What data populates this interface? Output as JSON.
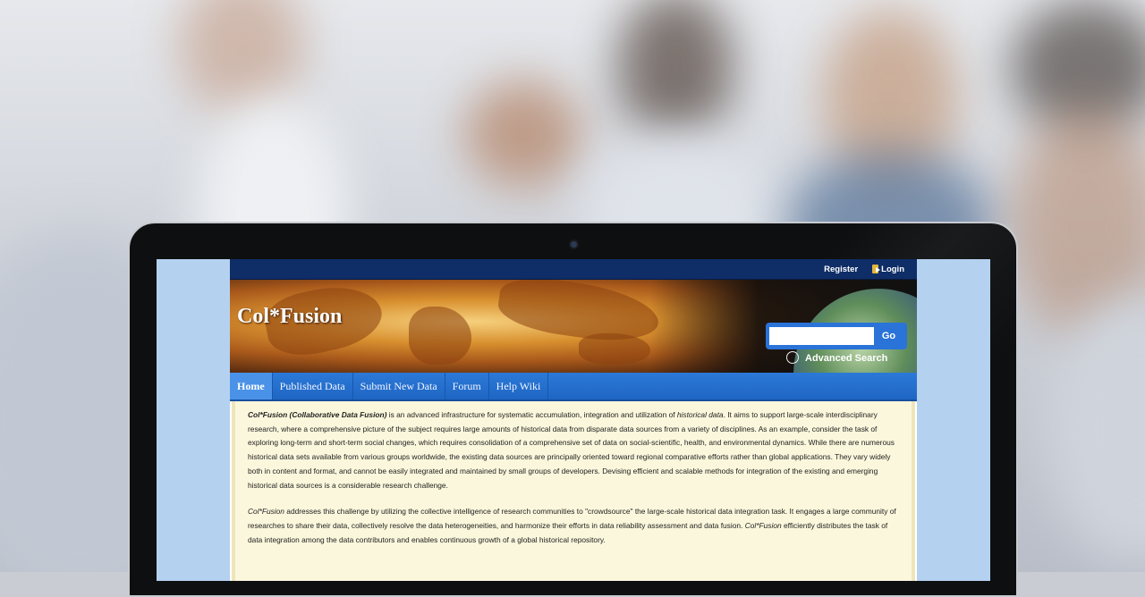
{
  "header": {
    "links": [
      "Register",
      "Login"
    ]
  },
  "banner": {
    "brand": "Col*Fusion",
    "search": {
      "placeholder": "",
      "button": "Go"
    },
    "advanced_search": "Advanced Search"
  },
  "nav": {
    "items": [
      "Home",
      "Published Data",
      "Submit New Data",
      "Forum",
      "Help Wiki"
    ],
    "active": "Home"
  },
  "content": {
    "p1": {
      "lead": "Col*Fusion (Collaborative Data Fusion)",
      "a": " is an advanced infrastructure for systematic accumulation, integration and utilization of ",
      "em": "historical data",
      "b": ". It aims to support large-scale interdisciplinary research, where a comprehensive picture of the subject requires large amounts of historical data from disparate data sources from a variety of disciplines. As an example, consider the task of exploring long-term and short-term social changes, which requires consolidation of a comprehensive set of data on social-scientific, health, and environmental dynamics. While there are numerous historical data sets available from various groups worldwide, the existing data sources are principally oriented toward regional comparative efforts rather than global applications. They vary widely both in content and format, and cannot be easily integrated and maintained by small groups of developers. Devising efficient and scalable methods for integration of the existing and emerging historical data sources is a considerable research challenge."
    },
    "p2": {
      "lead": "Col*Fusion",
      "a": " addresses this challenge by utilizing the collective intelligence of research communities to \"crowdsource\" the large-scale historical data integration task. It engages a large community of researches to share their data, collectively resolve the data heterogeneities, and harmonize their efforts in data reliability assessment and data fusion. ",
      "lead2": "Col*Fusion",
      "b": " efficiently distributes the task of data integration among the data contributors and enables continuous growth of a global historical repository."
    }
  }
}
